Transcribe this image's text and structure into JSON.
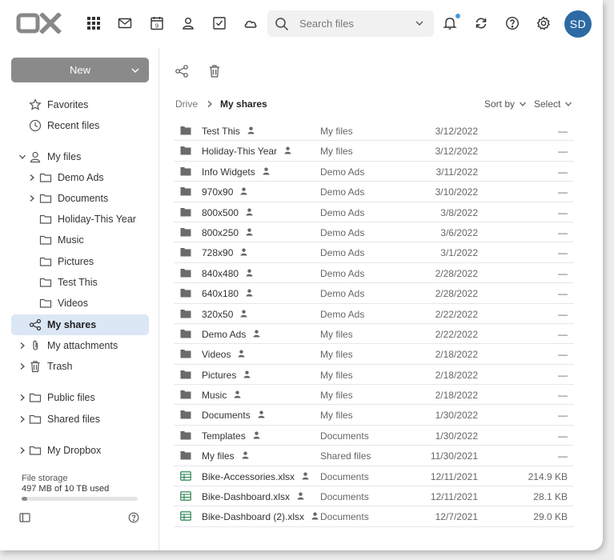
{
  "header": {
    "logo_text": "OX",
    "search_placeholder": "Search files",
    "calendar_day": "9",
    "avatar_initials": "SD",
    "colors": {
      "avatar": "#2d6aa3",
      "notification": "#4a9ad8"
    }
  },
  "sidebar": {
    "new_label": "New",
    "favorites": "Favorites",
    "recent": "Recent files",
    "my_files": "My files",
    "demo_ads": "Demo Ads",
    "documents": "Documents",
    "holiday": "Holiday-This Year",
    "music": "Music",
    "pictures": "Pictures",
    "test_this": "Test This",
    "videos": "Videos",
    "my_shares": "My shares",
    "my_attachments": "My attachments",
    "trash": "Trash",
    "public_files": "Public files",
    "shared_files": "Shared files",
    "my_dropbox": "My Dropbox",
    "storage_title": "File storage",
    "storage_used": "497 MB of 10 TB used",
    "storage_fraction": 0.05
  },
  "main": {
    "breadcrumb": {
      "root": "Drive",
      "current": "My shares"
    },
    "sort_label": "Sort by",
    "select_label": "Select",
    "files": [
      {
        "name": "Test This",
        "location": "My files",
        "date": "3/12/2022",
        "size": "—",
        "type": "folder"
      },
      {
        "name": "Holiday-This Year",
        "location": "My files",
        "date": "3/12/2022",
        "size": "—",
        "type": "folder"
      },
      {
        "name": "Info Widgets",
        "location": "Demo Ads",
        "date": "3/11/2022",
        "size": "—",
        "type": "folder"
      },
      {
        "name": "970x90",
        "location": "Demo Ads",
        "date": "3/10/2022",
        "size": "—",
        "type": "folder"
      },
      {
        "name": "800x500",
        "location": "Demo Ads",
        "date": "3/8/2022",
        "size": "—",
        "type": "folder"
      },
      {
        "name": "800x250",
        "location": "Demo Ads",
        "date": "3/6/2022",
        "size": "—",
        "type": "folder"
      },
      {
        "name": "728x90",
        "location": "Demo Ads",
        "date": "3/1/2022",
        "size": "—",
        "type": "folder"
      },
      {
        "name": "840x480",
        "location": "Demo Ads",
        "date": "2/28/2022",
        "size": "—",
        "type": "folder"
      },
      {
        "name": "640x180",
        "location": "Demo Ads",
        "date": "2/28/2022",
        "size": "—",
        "type": "folder"
      },
      {
        "name": "320x50",
        "location": "Demo Ads",
        "date": "2/22/2022",
        "size": "—",
        "type": "folder"
      },
      {
        "name": "Demo Ads",
        "location": "My files",
        "date": "2/22/2022",
        "size": "—",
        "type": "folder"
      },
      {
        "name": "Videos",
        "location": "My files",
        "date": "2/18/2022",
        "size": "—",
        "type": "folder"
      },
      {
        "name": "Pictures",
        "location": "My files",
        "date": "2/18/2022",
        "size": "—",
        "type": "folder"
      },
      {
        "name": "Music",
        "location": "My files",
        "date": "2/18/2022",
        "size": "—",
        "type": "folder"
      },
      {
        "name": "Documents",
        "location": "My files",
        "date": "1/30/2022",
        "size": "—",
        "type": "folder"
      },
      {
        "name": "Templates",
        "location": "Documents",
        "date": "1/30/2022",
        "size": "—",
        "type": "folder"
      },
      {
        "name": "My files",
        "location": "Shared files",
        "date": "11/30/2021",
        "size": "—",
        "type": "folder"
      },
      {
        "name": "Bike-Accessories.xlsx",
        "location": "Documents",
        "date": "12/11/2021",
        "size": "214.9 KB",
        "type": "spreadsheet"
      },
      {
        "name": "Bike-Dashboard.xlsx",
        "location": "Documents",
        "date": "12/11/2021",
        "size": "28.1 KB",
        "type": "spreadsheet"
      },
      {
        "name": "Bike-Dashboard (2).xlsx",
        "location": "Documents",
        "date": "12/7/2021",
        "size": "29.0 KB",
        "type": "spreadsheet"
      }
    ]
  },
  "icons": {
    "folder": "folder-icon",
    "spreadsheet": "spreadsheet-icon",
    "shared": "shared-person-icon"
  },
  "colors": {
    "folder": "#6b6b6b",
    "spreadsheet": "#1e7a45",
    "active_item_bg": "#dbe7f5",
    "new_button": "#8a8a8a"
  }
}
